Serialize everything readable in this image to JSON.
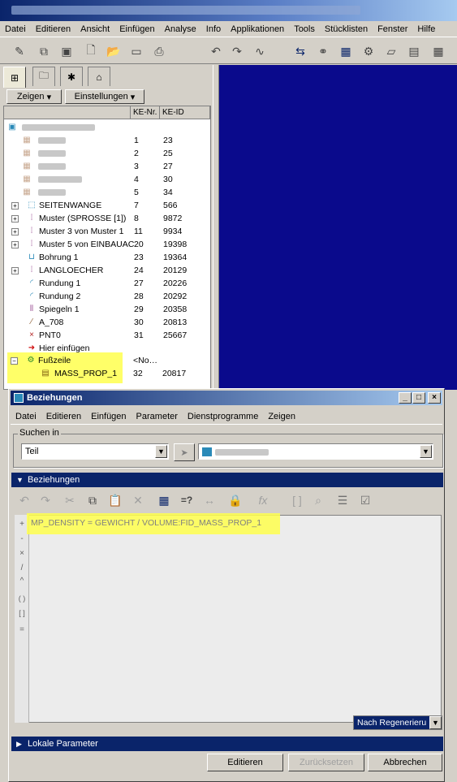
{
  "app": {
    "menu": [
      "Datei",
      "Editieren",
      "Ansicht",
      "Einfügen",
      "Analyse",
      "Info",
      "Applikationen",
      "Tools",
      "Stücklisten",
      "Fenster",
      "Hilfe"
    ]
  },
  "left_panel": {
    "show_label": "Zeigen",
    "settings_label": "Einstellungen",
    "col_nr": "KE-Nr.",
    "col_id": "KE-ID",
    "tree": [
      {
        "name": "SEITENWANGE",
        "nr": "7",
        "id": "566",
        "icon": "datum-feature-icon"
      },
      {
        "name": "Muster (SPROSSE [1])",
        "nr": "8",
        "id": "9872",
        "icon": "pattern-icon"
      },
      {
        "name": "Muster 3 von Muster 1",
        "nr": "11",
        "id": "9934",
        "icon": "pattern-icon"
      },
      {
        "name": "Muster 5 von EINBAUAC",
        "nr": "20",
        "id": "19398",
        "icon": "pattern-icon"
      },
      {
        "name": "Bohrung 1",
        "nr": "23",
        "id": "19364",
        "icon": "hole-icon"
      },
      {
        "name": "LANGLOECHER",
        "nr": "24",
        "id": "20129",
        "icon": "pattern-icon"
      },
      {
        "name": "Rundung 1",
        "nr": "27",
        "id": "20226",
        "icon": "round-icon"
      },
      {
        "name": "Rundung 2",
        "nr": "28",
        "id": "20292",
        "icon": "round-icon"
      },
      {
        "name": "Spiegeln 1",
        "nr": "29",
        "id": "20358",
        "icon": "mirror-icon"
      },
      {
        "name": "A_708",
        "nr": "30",
        "id": "20813",
        "icon": "axis-icon"
      },
      {
        "name": "PNT0",
        "nr": "31",
        "id": "25667",
        "icon": "point-icon"
      },
      {
        "name": "Hier einfügen",
        "nr": "",
        "id": "",
        "icon": "insert-arrow-icon"
      },
      {
        "name": "Fußzeile",
        "nr": "<No…",
        "id": "",
        "icon": "footer-icon"
      },
      {
        "name": "MASS_PROP_1",
        "nr": "32",
        "id": "20817",
        "icon": "analysis-icon"
      }
    ],
    "hidden_rows": [
      {
        "nr": "1",
        "id": "23"
      },
      {
        "nr": "2",
        "id": "25"
      },
      {
        "nr": "3",
        "id": "27"
      },
      {
        "nr": "4",
        "id": "30"
      },
      {
        "nr": "5",
        "id": "34"
      }
    ]
  },
  "dialog": {
    "title": "Beziehungen",
    "menu": [
      "Datei",
      "Editieren",
      "Einfügen",
      "Parameter",
      "Dienstprogramme",
      "Zeigen"
    ],
    "search_label": "Suchen in",
    "search_type": "Teil",
    "section_relations": "Beziehungen",
    "relation_text": "MP_DENSITY = GEWICHT / VOLUME:FID_MASS_PROP_1",
    "gutter_symbols": [
      "+",
      "-",
      "×",
      "/",
      "^",
      "( )",
      "[ ]",
      "="
    ],
    "regen_option": "Nach Regenerieru",
    "section_local": "Lokale Parameter",
    "btn_edit": "Editieren",
    "btn_reset": "Zurücksetzen",
    "btn_cancel": "Abbrechen"
  }
}
